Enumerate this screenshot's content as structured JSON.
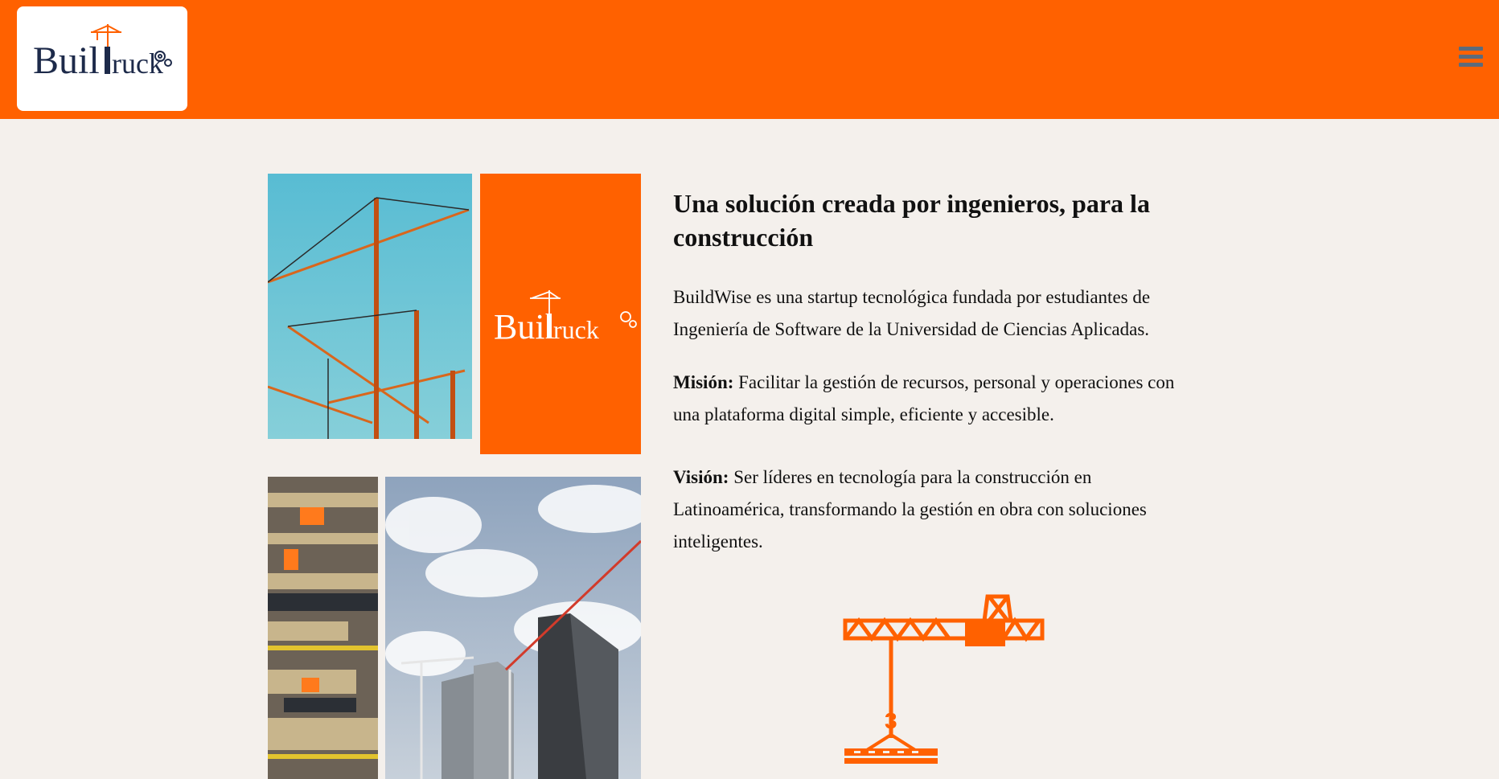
{
  "header": {
    "logo_text_left": "Buil",
    "logo_text_right": "ruck",
    "background_color": "#ff6100"
  },
  "about": {
    "heading": "Una solución creada por ingenieros, para la construcción",
    "intro": "BuildWise es una startup tecnológica fundada por estudiantes de Ingeniería de Software de la Universidad de Ciencias Aplicadas.",
    "mission_label": "Misión:",
    "mission_text": " Facilitar la gestión de recursos, personal y operaciones con una plataforma digital simple, eficiente y accesible.",
    "vision_label": "Visión:",
    "vision_text": " Ser líderes en tecnología para la construcción en Latinoamérica, transformando la gestión en obra con soluciones inteligentes."
  },
  "icons": {
    "menu": "hamburger-menu-icon",
    "crane": "crane-icon",
    "gear": "gear-icon"
  },
  "colors": {
    "accent": "#ff6100",
    "background": "#f4f0ec",
    "logo_navy": "#1d2a4a"
  }
}
